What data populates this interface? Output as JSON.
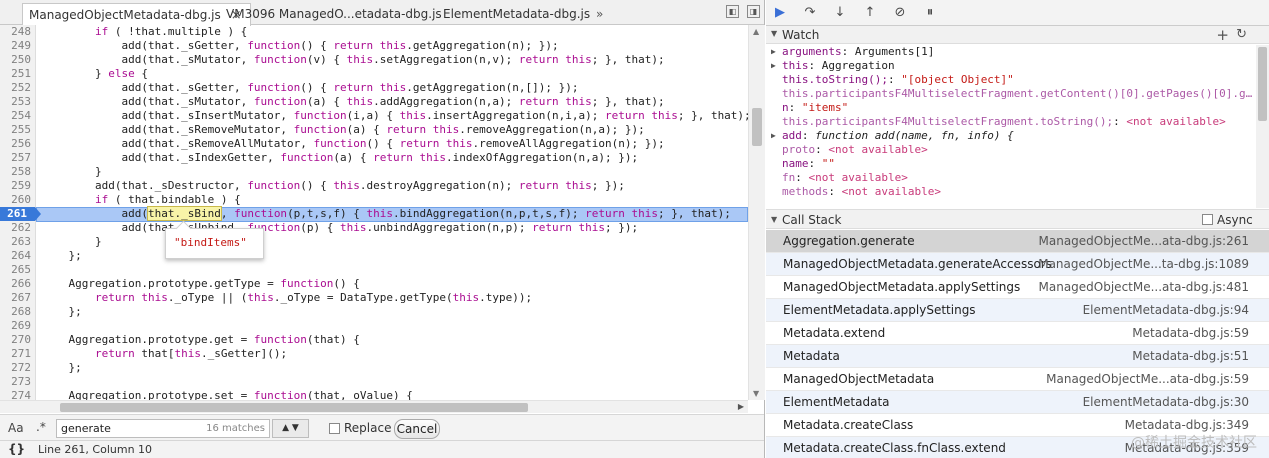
{
  "tabs": [
    {
      "label": "ManagedObjectMetadata-dbg.js",
      "active": true
    },
    {
      "label": "VM3096 ManagedO...etadata-dbg.js",
      "active": false
    },
    {
      "label": "ElementMetadata-dbg.js",
      "active": false
    }
  ],
  "tab_more": "»",
  "tab_close": "×",
  "code_lines": [
    {
      "n": "248",
      "t": "        if ( !that.multiple ) {"
    },
    {
      "n": "249",
      "t": "            add(that._sGetter, function() { return this.getAggregation(n); });"
    },
    {
      "n": "250",
      "t": "            add(that._sMutator, function(v) { this.setAggregation(n,v); return this; }, that);"
    },
    {
      "n": "251",
      "t": "        } else {"
    },
    {
      "n": "252",
      "t": "            add(that._sGetter, function() { return this.getAggregation(n,[]); });"
    },
    {
      "n": "253",
      "t": "            add(that._sMutator, function(a) { this.addAggregation(n,a); return this; }, that);"
    },
    {
      "n": "254",
      "t": "            add(that._sInsertMutator, function(i,a) { this.insertAggregation(n,i,a); return this; }, that);"
    },
    {
      "n": "255",
      "t": "            add(that._sRemoveMutator, function(a) { return this.removeAggregation(n,a); });"
    },
    {
      "n": "256",
      "t": "            add(that._sRemoveAllMutator, function() { return this.removeAllAggregation(n); });"
    },
    {
      "n": "257",
      "t": "            add(that._sIndexGetter, function(a) { return this.indexOfAggregation(n,a); });"
    },
    {
      "n": "258",
      "t": "        }"
    },
    {
      "n": "259",
      "t": "        add(that._sDestructor, function() { this.destroyAggregation(n); return this; });"
    },
    {
      "n": "260",
      "t": "        if ( that.bindable ) {"
    },
    {
      "n": "261",
      "t": "            add(that._sBind, function(p,t,s,f) { this.bindAggregation(n,p,t,s,f); return this; }, that);"
    },
    {
      "n": "262",
      "t": "            add(that._sUnbind, function(p) { this.unbindAggregation(n,p); return this; });"
    },
    {
      "n": "263",
      "t": "        }"
    },
    {
      "n": "264",
      "t": "    };"
    },
    {
      "n": "265",
      "t": ""
    },
    {
      "n": "266",
      "t": "    Aggregation.prototype.getType = function() {"
    },
    {
      "n": "267",
      "t": "        return this._oType || (this._oType = DataType.getType(this.type));"
    },
    {
      "n": "268",
      "t": "    };"
    },
    {
      "n": "269",
      "t": ""
    },
    {
      "n": "270",
      "t": "    Aggregation.prototype.get = function(that) {"
    },
    {
      "n": "271",
      "t": "        return that[this._sGetter]();"
    },
    {
      "n": "272",
      "t": "    };"
    },
    {
      "n": "273",
      "t": ""
    },
    {
      "n": "274",
      "t": "    Aggregation.prototype.set = function(that, oValue) {"
    }
  ],
  "breakpoint_line": "261",
  "tooltip_value": "\"bindItems\"",
  "find": {
    "aa": "Aa",
    "regex": ".*",
    "query": "generate",
    "matches": "16 matches",
    "replace_label": "Replace",
    "cancel_label": "Cancel"
  },
  "status": {
    "icon": "{}",
    "position": "Line 261, Column 10"
  },
  "watch": {
    "title": "Watch",
    "add": "+",
    "refresh": "↻",
    "items": [
      {
        "name": "arguments",
        "sep": ": ",
        "val": "Arguments[1]",
        "exp": "▶",
        "cls": "wn",
        "vcls": ""
      },
      {
        "name": "this",
        "sep": ": ",
        "val": "Aggregation",
        "exp": "▶",
        "cls": "wn",
        "vcls": ""
      },
      {
        "name": "this.toString();",
        "sep": ": ",
        "val": "\"[object Object]\"",
        "exp": "",
        "cls": "wn",
        "vcls": "ws"
      },
      {
        "name": "this.participantsF4MultiselectFragment.getContent()[0].getPages()[0].g…",
        "sep": "",
        "val": "",
        "exp": "",
        "cls": "wn wdim",
        "vcls": ""
      },
      {
        "name": "n",
        "sep": ": ",
        "val": "\"items\"",
        "exp": "",
        "cls": "wn",
        "vcls": "ws"
      },
      {
        "name": "this.participantsF4MultiselectFragment.toString();",
        "sep": ": ",
        "val": "<not available>",
        "exp": "",
        "cls": "wn wdim",
        "vcls": "wna"
      },
      {
        "name": "add",
        "sep": ": ",
        "val": "function add(name, fn, info) {",
        "exp": "▶",
        "cls": "wn",
        "vcls": "wfn"
      },
      {
        "name": "  proto",
        "sep": ": ",
        "val": "<not available>",
        "exp": "",
        "cls": "wn wdim",
        "vcls": "wna"
      },
      {
        "name": "  name",
        "sep": ": ",
        "val": "\"\"",
        "exp": "",
        "cls": "wn",
        "vcls": "ws"
      },
      {
        "name": "  fn",
        "sep": ": ",
        "val": "<not available>",
        "exp": "",
        "cls": "wn wdim",
        "vcls": "wna"
      },
      {
        "name": "  methods",
        "sep": ": ",
        "val": "<not available>",
        "exp": "",
        "cls": "wn wdim",
        "vcls": "wna"
      }
    ]
  },
  "callstack": {
    "title": "Call Stack",
    "async_label": "Async",
    "frames": [
      {
        "fn": "Aggregation.generate",
        "loc": "ManagedObjectMe...ata-dbg.js:261",
        "state": "sel"
      },
      {
        "fn": "ManagedObjectMetadata.generateAccessors",
        "loc": "ManagedObjectMe...ta-dbg.js:1089",
        "state": "alt"
      },
      {
        "fn": "ManagedObjectMetadata.applySettings",
        "loc": "ManagedObjectMe...ata-dbg.js:481",
        "state": ""
      },
      {
        "fn": "ElementMetadata.applySettings",
        "loc": "ElementMetadata-dbg.js:94",
        "state": "alt"
      },
      {
        "fn": "Metadata.extend",
        "loc": "Metadata-dbg.js:59",
        "state": ""
      },
      {
        "fn": "Metadata",
        "loc": "Metadata-dbg.js:51",
        "state": "alt"
      },
      {
        "fn": "ManagedObjectMetadata",
        "loc": "ManagedObjectMe...ata-dbg.js:59",
        "state": ""
      },
      {
        "fn": "ElementMetadata",
        "loc": "ElementMetadata-dbg.js:30",
        "state": "alt"
      },
      {
        "fn": "Metadata.createClass",
        "loc": "Metadata-dbg.js:349",
        "state": ""
      },
      {
        "fn": "Metadata.createClass.fnClass.extend",
        "loc": "Metadata-dbg.js:359",
        "state": "alt"
      }
    ]
  },
  "watermark": "@稀土掘金技术社区"
}
